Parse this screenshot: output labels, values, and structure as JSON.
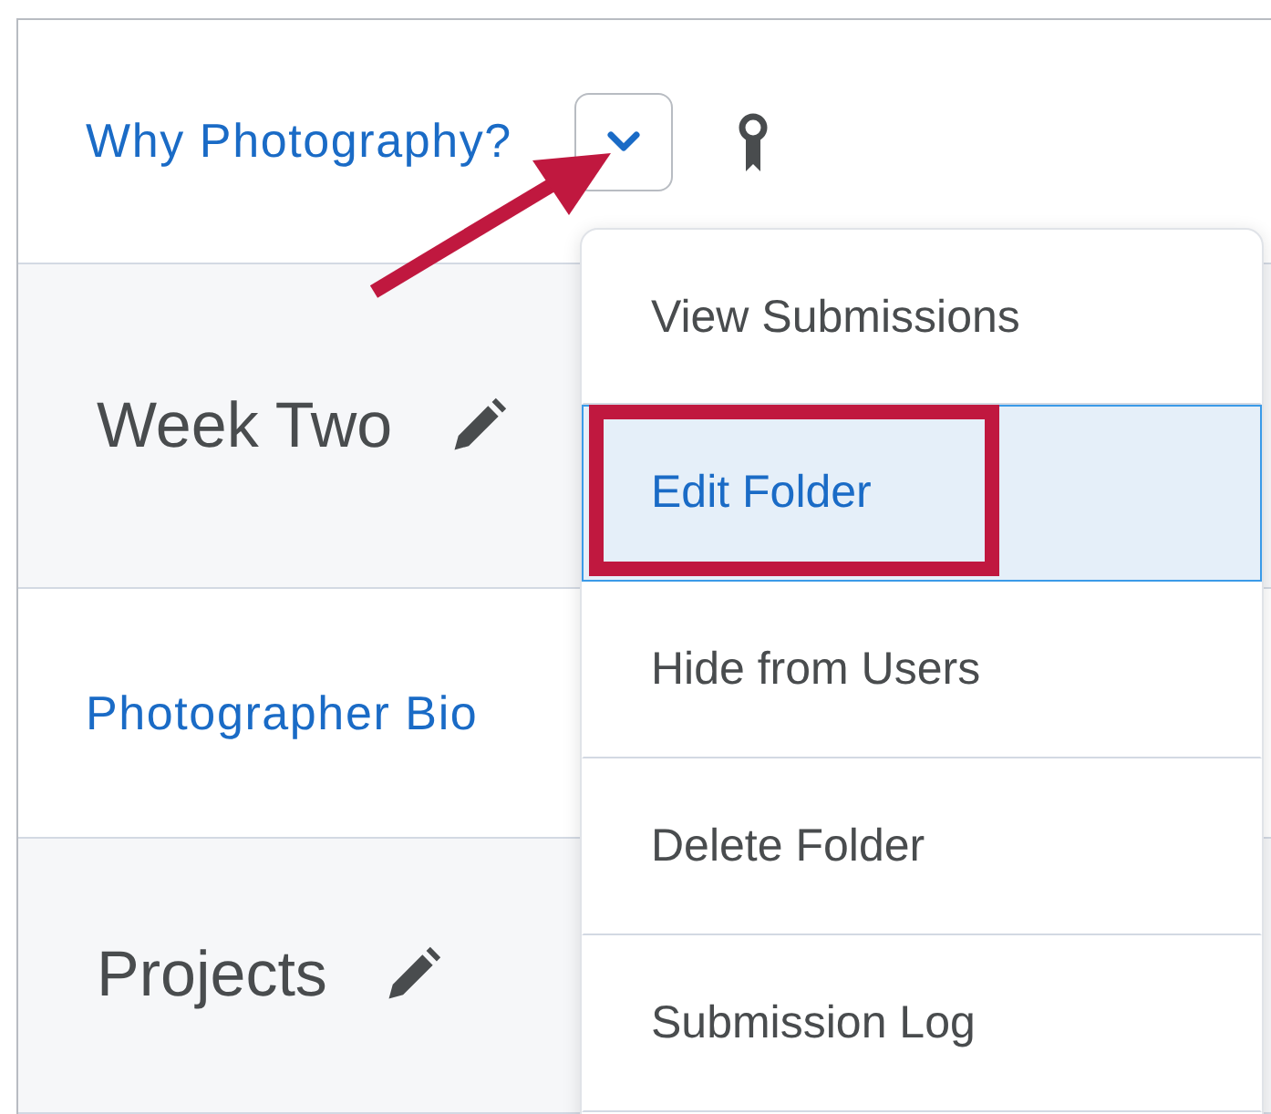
{
  "rows": [
    {
      "kind": "link",
      "title": "Why Photography?",
      "menu_button": true
    },
    {
      "kind": "heading",
      "title": "Week Two"
    },
    {
      "kind": "link",
      "title": "Photographer Bio",
      "menu_button": false
    },
    {
      "kind": "heading",
      "title": "Projects"
    }
  ],
  "menu": {
    "items": [
      {
        "label": "View Submissions",
        "selected": false
      },
      {
        "label": "Edit Folder",
        "selected": true
      },
      {
        "label": "Hide from Users",
        "selected": false
      },
      {
        "label": "Delete Folder",
        "selected": false
      },
      {
        "label": "Submission Log",
        "selected": false
      }
    ]
  }
}
